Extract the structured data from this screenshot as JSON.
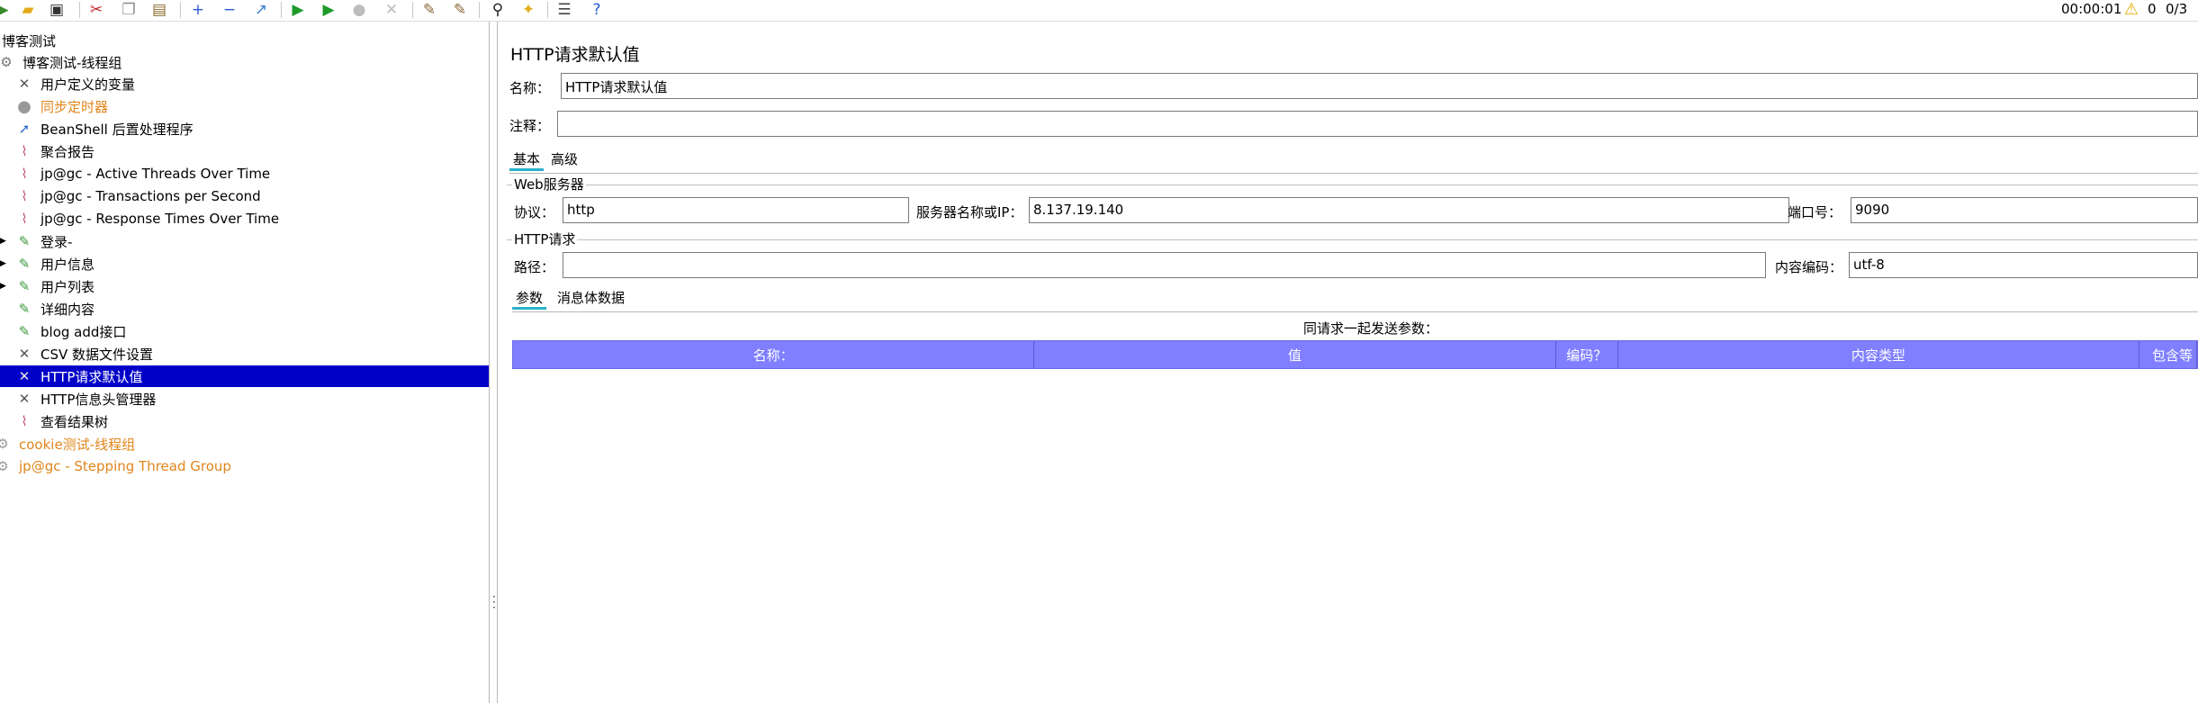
{
  "toolbar": {
    "icons": [
      "template-icon",
      "open-icon",
      "save-icon",
      "cut-icon",
      "copy-icon",
      "paste-icon",
      "expand-icon",
      "collapse-icon",
      "toggle-icon",
      "start-icon",
      "start-no-pause-icon",
      "stop-icon",
      "shutdown-icon",
      "clear-icon",
      "clear-all-icon",
      "search-icon",
      "reset-search-icon",
      "function-helper-icon",
      "help-icon"
    ],
    "elapsed_time": "00:00:01",
    "warning_count": "0",
    "thread_count": "0/3"
  },
  "tree": {
    "root": "博客测试",
    "items": [
      {
        "label": "博客测试-线程组",
        "icon": "gear-icon",
        "style": "normal"
      },
      {
        "label": "用户定义的变量",
        "icon": "config-tool-icon",
        "style": "normal"
      },
      {
        "label": "同步定时器",
        "icon": "timer-icon",
        "style": "orange"
      },
      {
        "label": "BeanShell 后置处理程序",
        "icon": "postprocessor-icon",
        "style": "normal"
      },
      {
        "label": "聚合报告",
        "icon": "chart-icon",
        "style": "normal"
      },
      {
        "label": "jp@gc - Active Threads Over Time",
        "icon": "chart-icon",
        "style": "normal"
      },
      {
        "label": "jp@gc - Transactions per Second",
        "icon": "chart-icon",
        "style": "normal"
      },
      {
        "label": "jp@gc - Response Times Over Time",
        "icon": "chart-icon",
        "style": "normal"
      },
      {
        "label": "登录-",
        "icon": "pipette-icon",
        "style": "normal"
      },
      {
        "label": "用户信息",
        "icon": "pipette-icon",
        "style": "normal"
      },
      {
        "label": "用户列表",
        "icon": "pipette-icon",
        "style": "normal"
      },
      {
        "label": "详细内容",
        "icon": "pipette-icon",
        "style": "normal"
      },
      {
        "label": "blog add接口",
        "icon": "pipette-icon",
        "style": "normal"
      },
      {
        "label": "CSV 数据文件设置",
        "icon": "config-tool-icon",
        "style": "normal"
      },
      {
        "label": "HTTP请求默认值",
        "icon": "config-tool-icon",
        "style": "selected"
      },
      {
        "label": "HTTP信息头管理器",
        "icon": "config-tool-icon",
        "style": "normal"
      },
      {
        "label": "查看结果树",
        "icon": "chart-icon",
        "style": "normal"
      },
      {
        "label": "cookie测试-线程组",
        "icon": "gear-icon",
        "style": "orange"
      },
      {
        "label": "jp@gc - Stepping Thread Group",
        "icon": "gear-icon",
        "style": "orange"
      }
    ]
  },
  "panel": {
    "title": "HTTP请求默认值",
    "name_label": "名称：",
    "name_value": "HTTP请求默认值",
    "comment_label": "注释：",
    "comment_value": "",
    "tabs": [
      "基本",
      "高级"
    ],
    "web_server": {
      "group_title": "Web服务器",
      "protocol_label": "协议：",
      "protocol_value": "http",
      "server_label": "服务器名称或IP：",
      "server_value": "8.137.19.140",
      "port_label": "端口号：",
      "port_value": "9090"
    },
    "http_request": {
      "group_title": "HTTP请求",
      "path_label": "路径：",
      "path_value": "",
      "encoding_label": "内容编码：",
      "encoding_value": "utf-8"
    },
    "sub_tabs": [
      "参数",
      "消息体数据"
    ],
    "params_caption": "同请求一起发送参数：",
    "params_columns": [
      "名称：",
      "值",
      "编码？",
      "内容类型",
      "包含等"
    ]
  }
}
